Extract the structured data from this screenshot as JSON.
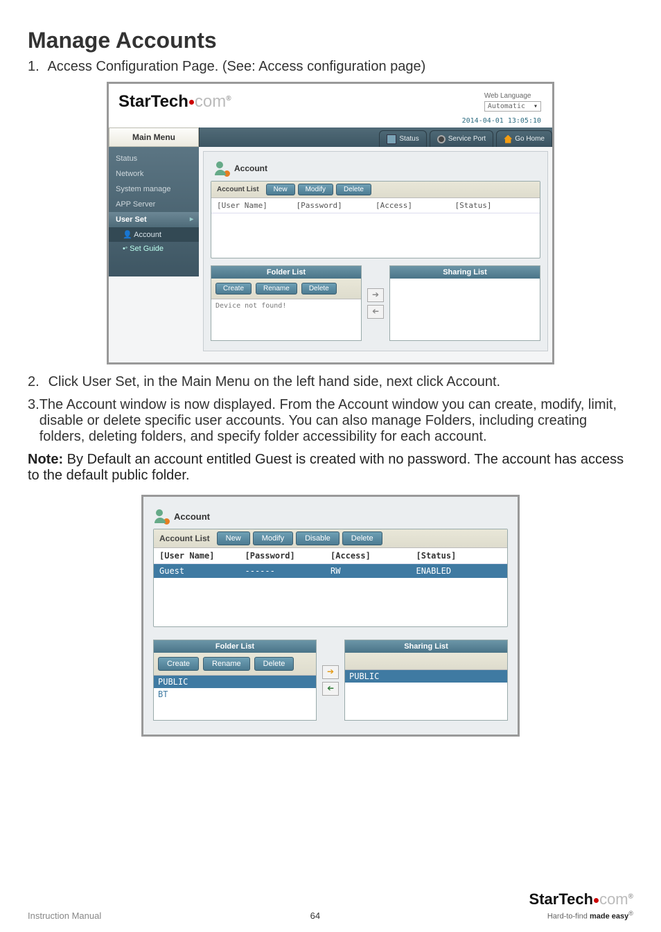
{
  "heading": "Manage Accounts",
  "steps": {
    "s1": "Access Configuration Page. (See: Access configuration page)",
    "s2": "Click User Set, in the Main Menu on the left hand side, next click Account.",
    "s3": "The Account window is now displayed.  From the Account window you can create, modify, limit, disable or delete specific user accounts. You can also manage Folders, including creating folders, deleting folders, and specify folder accessibility for each account."
  },
  "note_label": "Note:",
  "note_body": " By Default an account entitled Guest is created with no password. The account has access to the default public folder.",
  "fig1": {
    "brand_gray": "com",
    "lang_label": "Web Language",
    "lang_value": "Automatic",
    "timestamp": "2014-04-01 13:05:10",
    "side_title": "Main Menu",
    "side_items": {
      "i1": "Status",
      "i2": "Network",
      "i3": "System manage",
      "i4": "APP Server",
      "group": "User Set",
      "sub1": "Account",
      "sub2": "Set Guide"
    },
    "tabs": {
      "t1": "Status",
      "t2": "Service Port",
      "t3": "Go Home"
    },
    "panel_title": "Account",
    "account_list": {
      "tab": "Account List",
      "btn_new": "New",
      "btn_modify": "Modify",
      "btn_delete": "Delete",
      "col_user": "[User Name]",
      "col_pass": "[Password]",
      "col_access": "[Access]",
      "col_status": "[Status]"
    },
    "folder_list": {
      "title": "Folder List",
      "btn_create": "Create",
      "btn_rename": "Rename",
      "btn_delete": "Delete",
      "msg": "Device not found!"
    },
    "sharing_list": {
      "title": "Sharing List"
    }
  },
  "fig2": {
    "panel_title": "Account",
    "account_list": {
      "tab": "Account List",
      "btn_new": "New",
      "btn_modify": "Modify",
      "btn_disable": "Disable",
      "btn_delete": "Delete",
      "col_user": "[User Name]",
      "col_pass": "[Password]",
      "col_access": "[Access]",
      "col_status": "[Status]",
      "row_user": "Guest",
      "row_pass": "------",
      "row_access": "RW",
      "row_status": "ENABLED"
    },
    "folder_list": {
      "title": "Folder List",
      "btn_create": "Create",
      "btn_rename": "Rename",
      "btn_delete": "Delete",
      "r1": "PUBLIC",
      "r2": "BT"
    },
    "sharing_list": {
      "title": "Sharing List",
      "r1": "PUBLIC"
    }
  },
  "footer": {
    "left": "Instruction Manual",
    "page": "64",
    "brand_gray": "com",
    "sub_a": "Hard-to-find ",
    "sub_b": "made easy"
  }
}
